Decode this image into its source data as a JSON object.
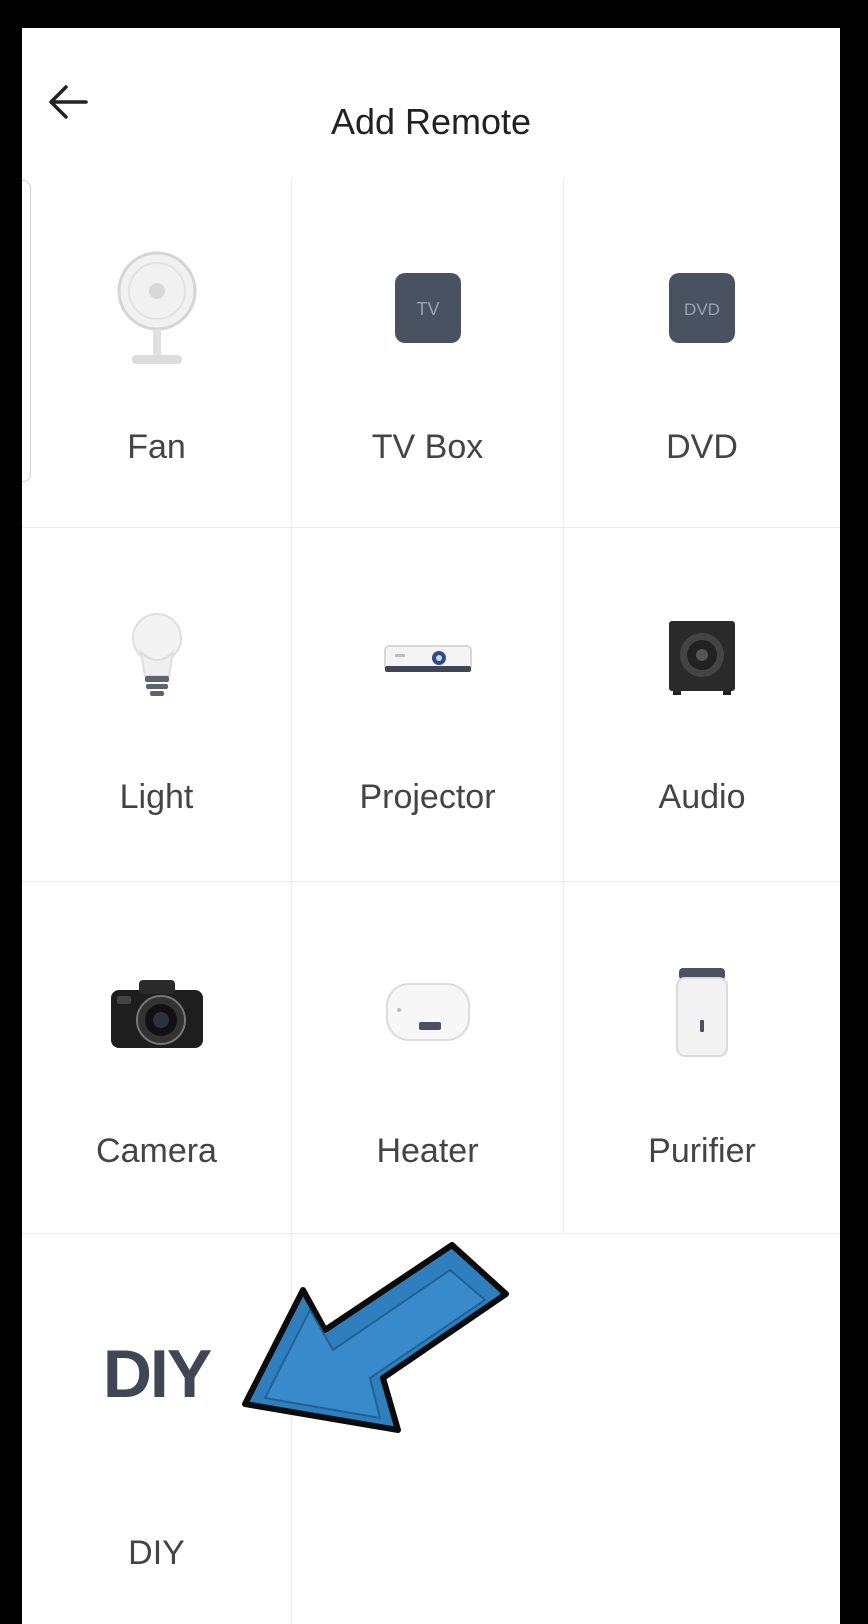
{
  "header": {
    "title": "Add Remote"
  },
  "devices": [
    {
      "label": "Fan",
      "icon": "fan-icon"
    },
    {
      "label": "TV Box",
      "icon": "tv-box-icon",
      "badge": "TV"
    },
    {
      "label": "DVD",
      "icon": "dvd-icon",
      "badge": "DVD"
    },
    {
      "label": "Light",
      "icon": "light-bulb-icon"
    },
    {
      "label": "Projector",
      "icon": "projector-icon"
    },
    {
      "label": "Audio",
      "icon": "speaker-icon"
    },
    {
      "label": "Camera",
      "icon": "camera-icon"
    },
    {
      "label": "Heater",
      "icon": "heater-icon"
    },
    {
      "label": "Purifier",
      "icon": "purifier-icon"
    },
    {
      "label": "DIY",
      "icon": "diy-icon",
      "badge": "DIY"
    }
  ],
  "colors": {
    "device_dark": "#4a5262",
    "arrow": "#2f7fbf",
    "divider": "#ececec"
  }
}
